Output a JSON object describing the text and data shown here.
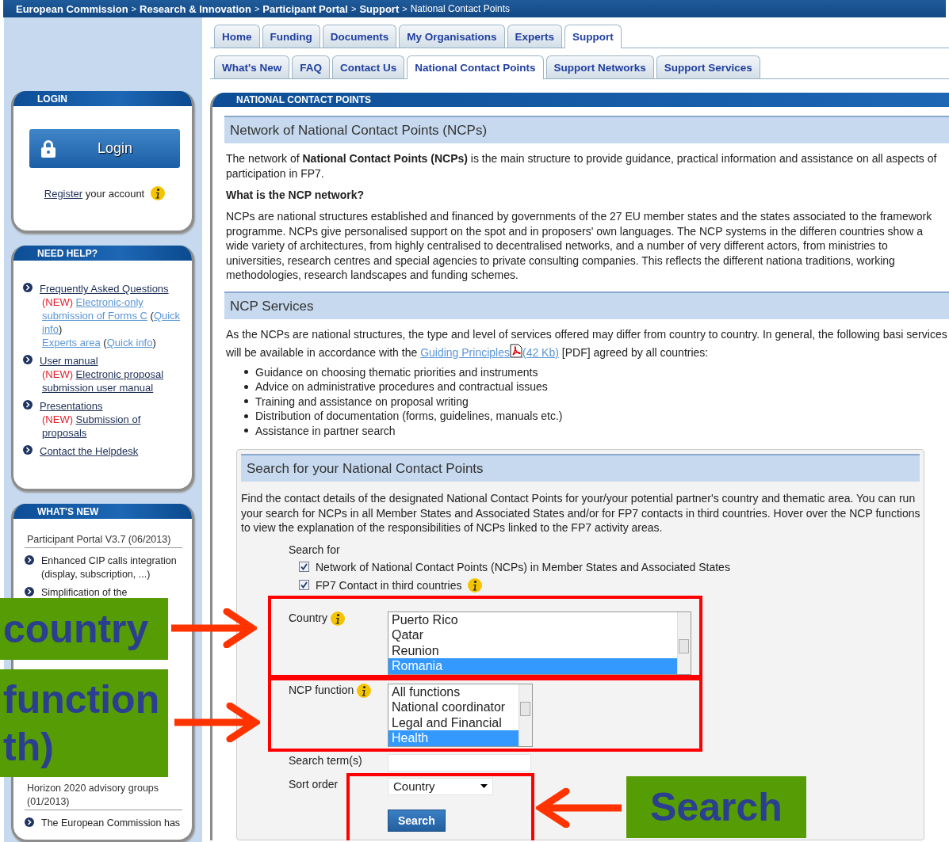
{
  "breadcrumb": [
    {
      "label": "European Commission",
      "current": false
    },
    {
      "label": "Research & Innovation",
      "current": false
    },
    {
      "label": "Participant Portal",
      "current": false
    },
    {
      "label": "Support",
      "current": false
    },
    {
      "label": "National Contact Points",
      "current": true
    }
  ],
  "breadcrumb_separator": ">",
  "main_tabs": [
    {
      "label": "Home",
      "selected": false
    },
    {
      "label": "Funding",
      "selected": false
    },
    {
      "label": "Documents",
      "selected": false
    },
    {
      "label": "My Organisations",
      "selected": false
    },
    {
      "label": "Experts",
      "selected": false
    },
    {
      "label": "Support",
      "selected": true
    }
  ],
  "sub_tabs": [
    {
      "label": "What's New",
      "selected": false
    },
    {
      "label": "FAQ",
      "selected": false
    },
    {
      "label": "Contact Us",
      "selected": false
    },
    {
      "label": "National Contact Points",
      "selected": true
    },
    {
      "label": "Support Networks",
      "selected": false
    },
    {
      "label": "Support Services",
      "selected": false
    }
  ],
  "login_box": {
    "title": "LOGIN",
    "button": "Login",
    "register_link": "Register",
    "register_text": " your account"
  },
  "help_box": {
    "title": "NEED HELP?",
    "items": [
      {
        "link": "Frequently Asked Questions",
        "lines": [
          [
            {
              "kind": "new",
              "text": "(NEW) "
            },
            {
              "kind": "light_link",
              "text": "Electronic-only submission of Forms C"
            },
            {
              "kind": "text",
              "text": " ("
            },
            {
              "kind": "light_link",
              "text": "Quick info"
            },
            {
              "kind": "text",
              "text": ")"
            }
          ],
          [
            {
              "kind": "light_link",
              "text": "Experts area"
            },
            {
              "kind": "text",
              "text": " ("
            },
            {
              "kind": "light_link",
              "text": "Quick info"
            },
            {
              "kind": "text",
              "text": ")"
            }
          ]
        ]
      },
      {
        "link": "User manual",
        "lines": [
          [
            {
              "kind": "new",
              "text": "(NEW) "
            },
            {
              "kind": "link",
              "text": "Electronic proposal submission user manual"
            }
          ]
        ]
      },
      {
        "link": "Presentations",
        "lines": [
          [
            {
              "kind": "new",
              "text": "(NEW) "
            },
            {
              "kind": "link",
              "text": "Submission of proposals"
            }
          ]
        ]
      },
      {
        "link": "Contact the Helpdesk"
      }
    ]
  },
  "whats_new_box": {
    "title": "WHAT'S NEW",
    "groups": [
      {
        "heading": "Participant Portal V3.7 (06/2013)",
        "items": [
          "Enhanced CIP calls integration (display, subscription, ...)",
          "Simplification of the"
        ]
      },
      {
        "heading": "Horizon 2020 advisory groups (01/2013)",
        "items": [
          "The European Commission has"
        ]
      }
    ]
  },
  "panel": {
    "title": "NATIONAL CONTACT POINTS"
  },
  "network_section": {
    "heading": "Network of National Contact Points (NCPs)",
    "intro": "The network of **National Contact Points (NCPs)** is the main structure to provide guidance, practical information and assistance on all aspects of participation in FP7.",
    "question": "What is the NCP network?",
    "description": "NCPs are national structures established and financed by governments of the 27 EU member states and the states associated to the framework programme. NCPs give personalised support on the spot and in proposers' own languages. The NCP systems in the differen countries show a wide variety of architectures, from highly centralised to decentralised networks, and a number of very different actors, from ministries to universities, research centres and special agencies to private consulting companies. This reflects the different nationa traditions, working methodologies, research landscapes and funding schemes."
  },
  "services_section": {
    "heading": "NCP Services",
    "intro_parts": [
      {
        "kind": "text",
        "text": "As the NCPs are national structures, the type and level of services offered may differ from country to country. In general, the following basi services will be available in accordance with the "
      },
      {
        "kind": "light_link",
        "text": "Guiding Principles"
      },
      {
        "kind": "pdf"
      },
      {
        "kind": "light_link",
        "text": "(42 Kb)"
      },
      {
        "kind": "text",
        "text": " [PDF] agreed by all countries:"
      }
    ],
    "bullets": [
      "Guidance on choosing thematic priorities and instruments",
      "Advice on administrative procedures and contractual issues",
      "Training and assistance on proposal writing",
      "Distribution of documentation (forms, guidelines, manuals etc.)",
      "Assistance in partner search"
    ]
  },
  "search_panel": {
    "heading": "Search for your National Contact Points",
    "description": "Find the contact details of the designated National Contact Points for your/your potential partner's country and thematic area. You can run your search for NCPs in all Member States and Associated States and/or for FP7 contacts in third countries. Hover over the NCP functions to view the explanation of the responsibilities of NCPs linked to the FP7 activity areas.",
    "search_for_label": "Search for",
    "options": [
      {
        "label": "Network of National Contact Points (NCPs) in Member States and Associated States",
        "checked": true,
        "info": false
      },
      {
        "label": "FP7 Contact in third countries",
        "checked": true,
        "info": true
      }
    ],
    "country": {
      "label": "Country",
      "items": [
        {
          "text": "Puerto Rico",
          "selected": false
        },
        {
          "text": "Qatar",
          "selected": false
        },
        {
          "text": "Reunion",
          "selected": false
        },
        {
          "text": "Romania",
          "selected": true
        }
      ]
    },
    "ncp_function": {
      "label": "NCP function",
      "items": [
        {
          "text": "All functions",
          "selected": false
        },
        {
          "text": "National coordinator",
          "selected": false
        },
        {
          "text": "Legal and Financial",
          "selected": false
        },
        {
          "text": "Health",
          "selected": true
        }
      ]
    },
    "search_terms": {
      "label": "Search term(s)"
    },
    "sort_order": {
      "label": "Sort order",
      "value": "Country"
    },
    "button": "Search"
  },
  "annotations": [
    {
      "lines": [
        "country"
      ]
    },
    {
      "lines": [
        "function",
        "th)"
      ]
    },
    {
      "lines": [
        "Search"
      ]
    }
  ]
}
